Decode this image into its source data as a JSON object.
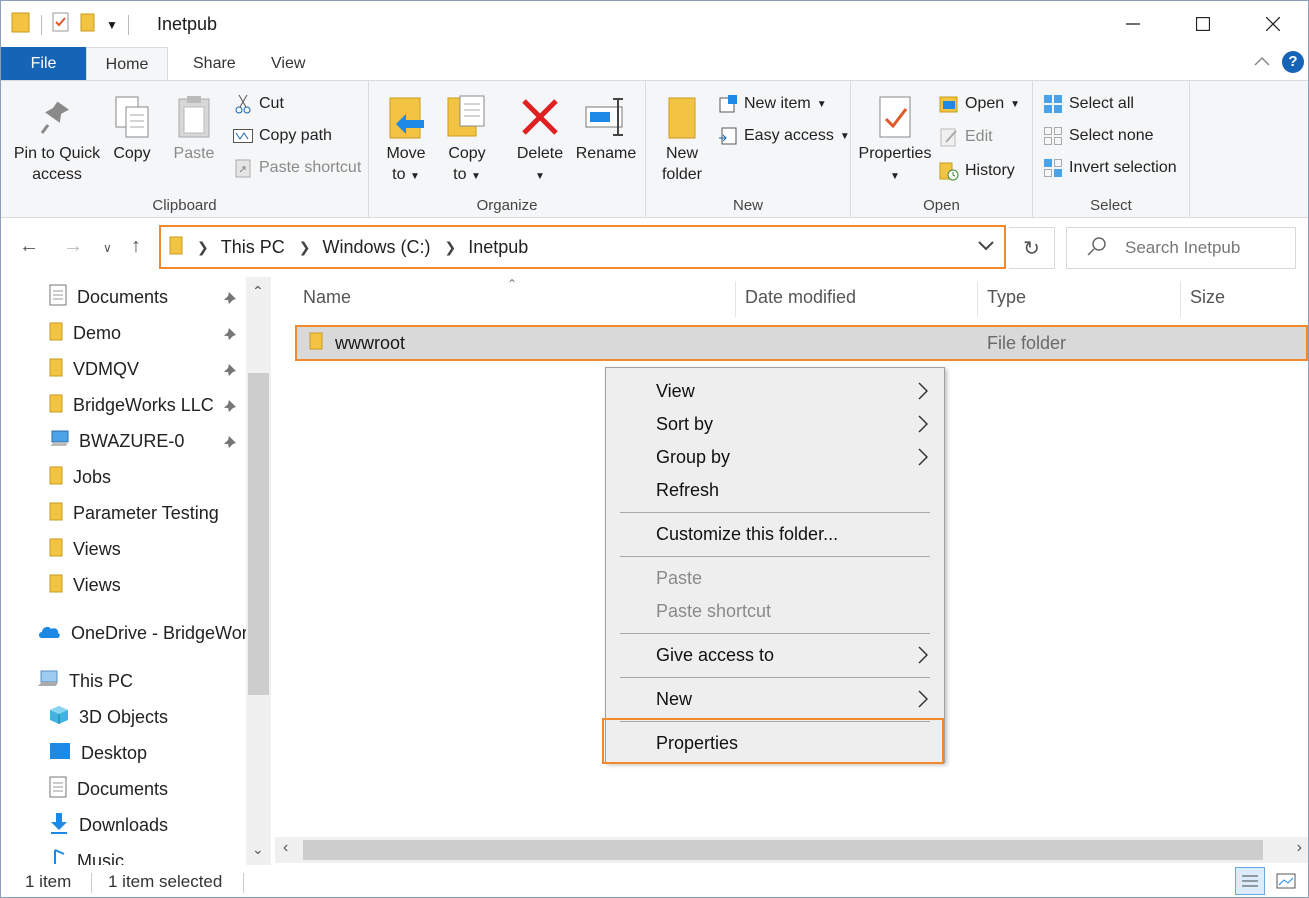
{
  "window": {
    "title": "Inetpub"
  },
  "tabs": {
    "file": "File",
    "home": "Home",
    "share": "Share",
    "view": "View"
  },
  "ribbon": {
    "clipboard": {
      "label": "Clipboard",
      "pin_l1": "Pin to Quick",
      "pin_l2": "access",
      "copy": "Copy",
      "paste": "Paste",
      "cut": "Cut",
      "copy_path": "Copy path",
      "paste_shortcut": "Paste shortcut"
    },
    "organize": {
      "label": "Organize",
      "move_l1": "Move",
      "move_l2": "to",
      "copy_l1": "Copy",
      "copy_l2": "to",
      "delete": "Delete",
      "rename": "Rename"
    },
    "new": {
      "label": "New",
      "new_folder_l1": "New",
      "new_folder_l2": "folder",
      "new_item": "New item",
      "easy_access": "Easy access"
    },
    "open": {
      "label": "Open",
      "properties": "Properties",
      "open": "Open",
      "edit": "Edit",
      "history": "History"
    },
    "select": {
      "label": "Select",
      "select_all": "Select all",
      "select_none": "Select none",
      "invert": "Invert selection"
    }
  },
  "address": {
    "crumbs": [
      "This PC",
      "Windows (C:)",
      "Inetpub"
    ],
    "search_placeholder": "Search Inetpub"
  },
  "nav": {
    "items": [
      "Documents",
      "Demo",
      "VDMQV",
      "BridgeWorks LLC",
      "BWAZURE-0",
      "Jobs",
      "Parameter Testing",
      "Views",
      "Views",
      "OneDrive - BridgeWorl",
      "This PC",
      "3D Objects",
      "Desktop",
      "Documents",
      "Downloads",
      "Music"
    ]
  },
  "columns": {
    "name": "Name",
    "date": "Date modified",
    "type": "Type",
    "size": "Size"
  },
  "files": [
    {
      "name": "wwwroot",
      "type": "File folder"
    }
  ],
  "context_menu": {
    "view": "View",
    "sort_by": "Sort by",
    "group_by": "Group by",
    "refresh": "Refresh",
    "customize": "Customize this folder...",
    "paste": "Paste",
    "paste_shortcut": "Paste shortcut",
    "give_access": "Give access to",
    "new": "New",
    "properties": "Properties"
  },
  "status": {
    "count": "1 item",
    "selected": "1 item selected"
  },
  "colors": {
    "accent": "#1664b5",
    "highlight": "#f08a2c",
    "folder": "#f3c443"
  }
}
